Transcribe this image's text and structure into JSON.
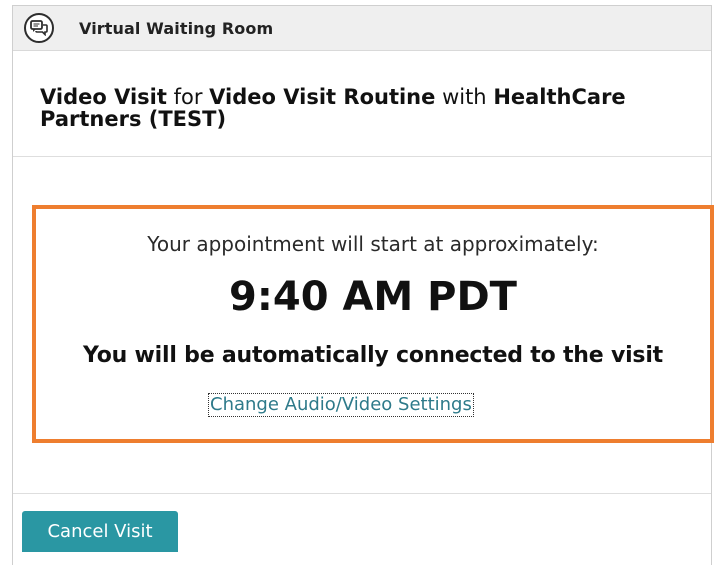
{
  "header": {
    "title": "Virtual Waiting Room",
    "icon": "chat-bubbles-icon"
  },
  "visit": {
    "type": "Video Visit",
    "for_word": "for",
    "reason": "Video Visit Routine",
    "with_word": "with",
    "provider": "HealthCare Partners (TEST)"
  },
  "appointment": {
    "approx_label": "Your appointment will start at approximately:",
    "time": "9:40 AM PDT",
    "connect_message": "You will be automatically connected to the visit",
    "settings_link": "Change Audio/Video Settings"
  },
  "actions": {
    "cancel_label": "Cancel Visit"
  },
  "colors": {
    "highlight_border": "#ee7e2f",
    "primary_button": "#2a97a3",
    "link": "#2e7a8a"
  }
}
